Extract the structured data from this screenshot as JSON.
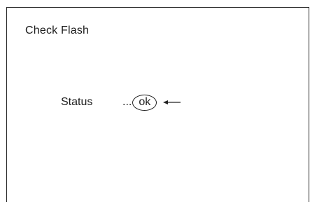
{
  "screen": {
    "title": "Check Flash",
    "status_label": "Status",
    "status_dots": "...",
    "status_value": "ok",
    "indicator_icon": "left-arrow-icon"
  },
  "colors": {
    "background": "#ffffff",
    "text": "#1a1a1a",
    "border": "#222222"
  }
}
